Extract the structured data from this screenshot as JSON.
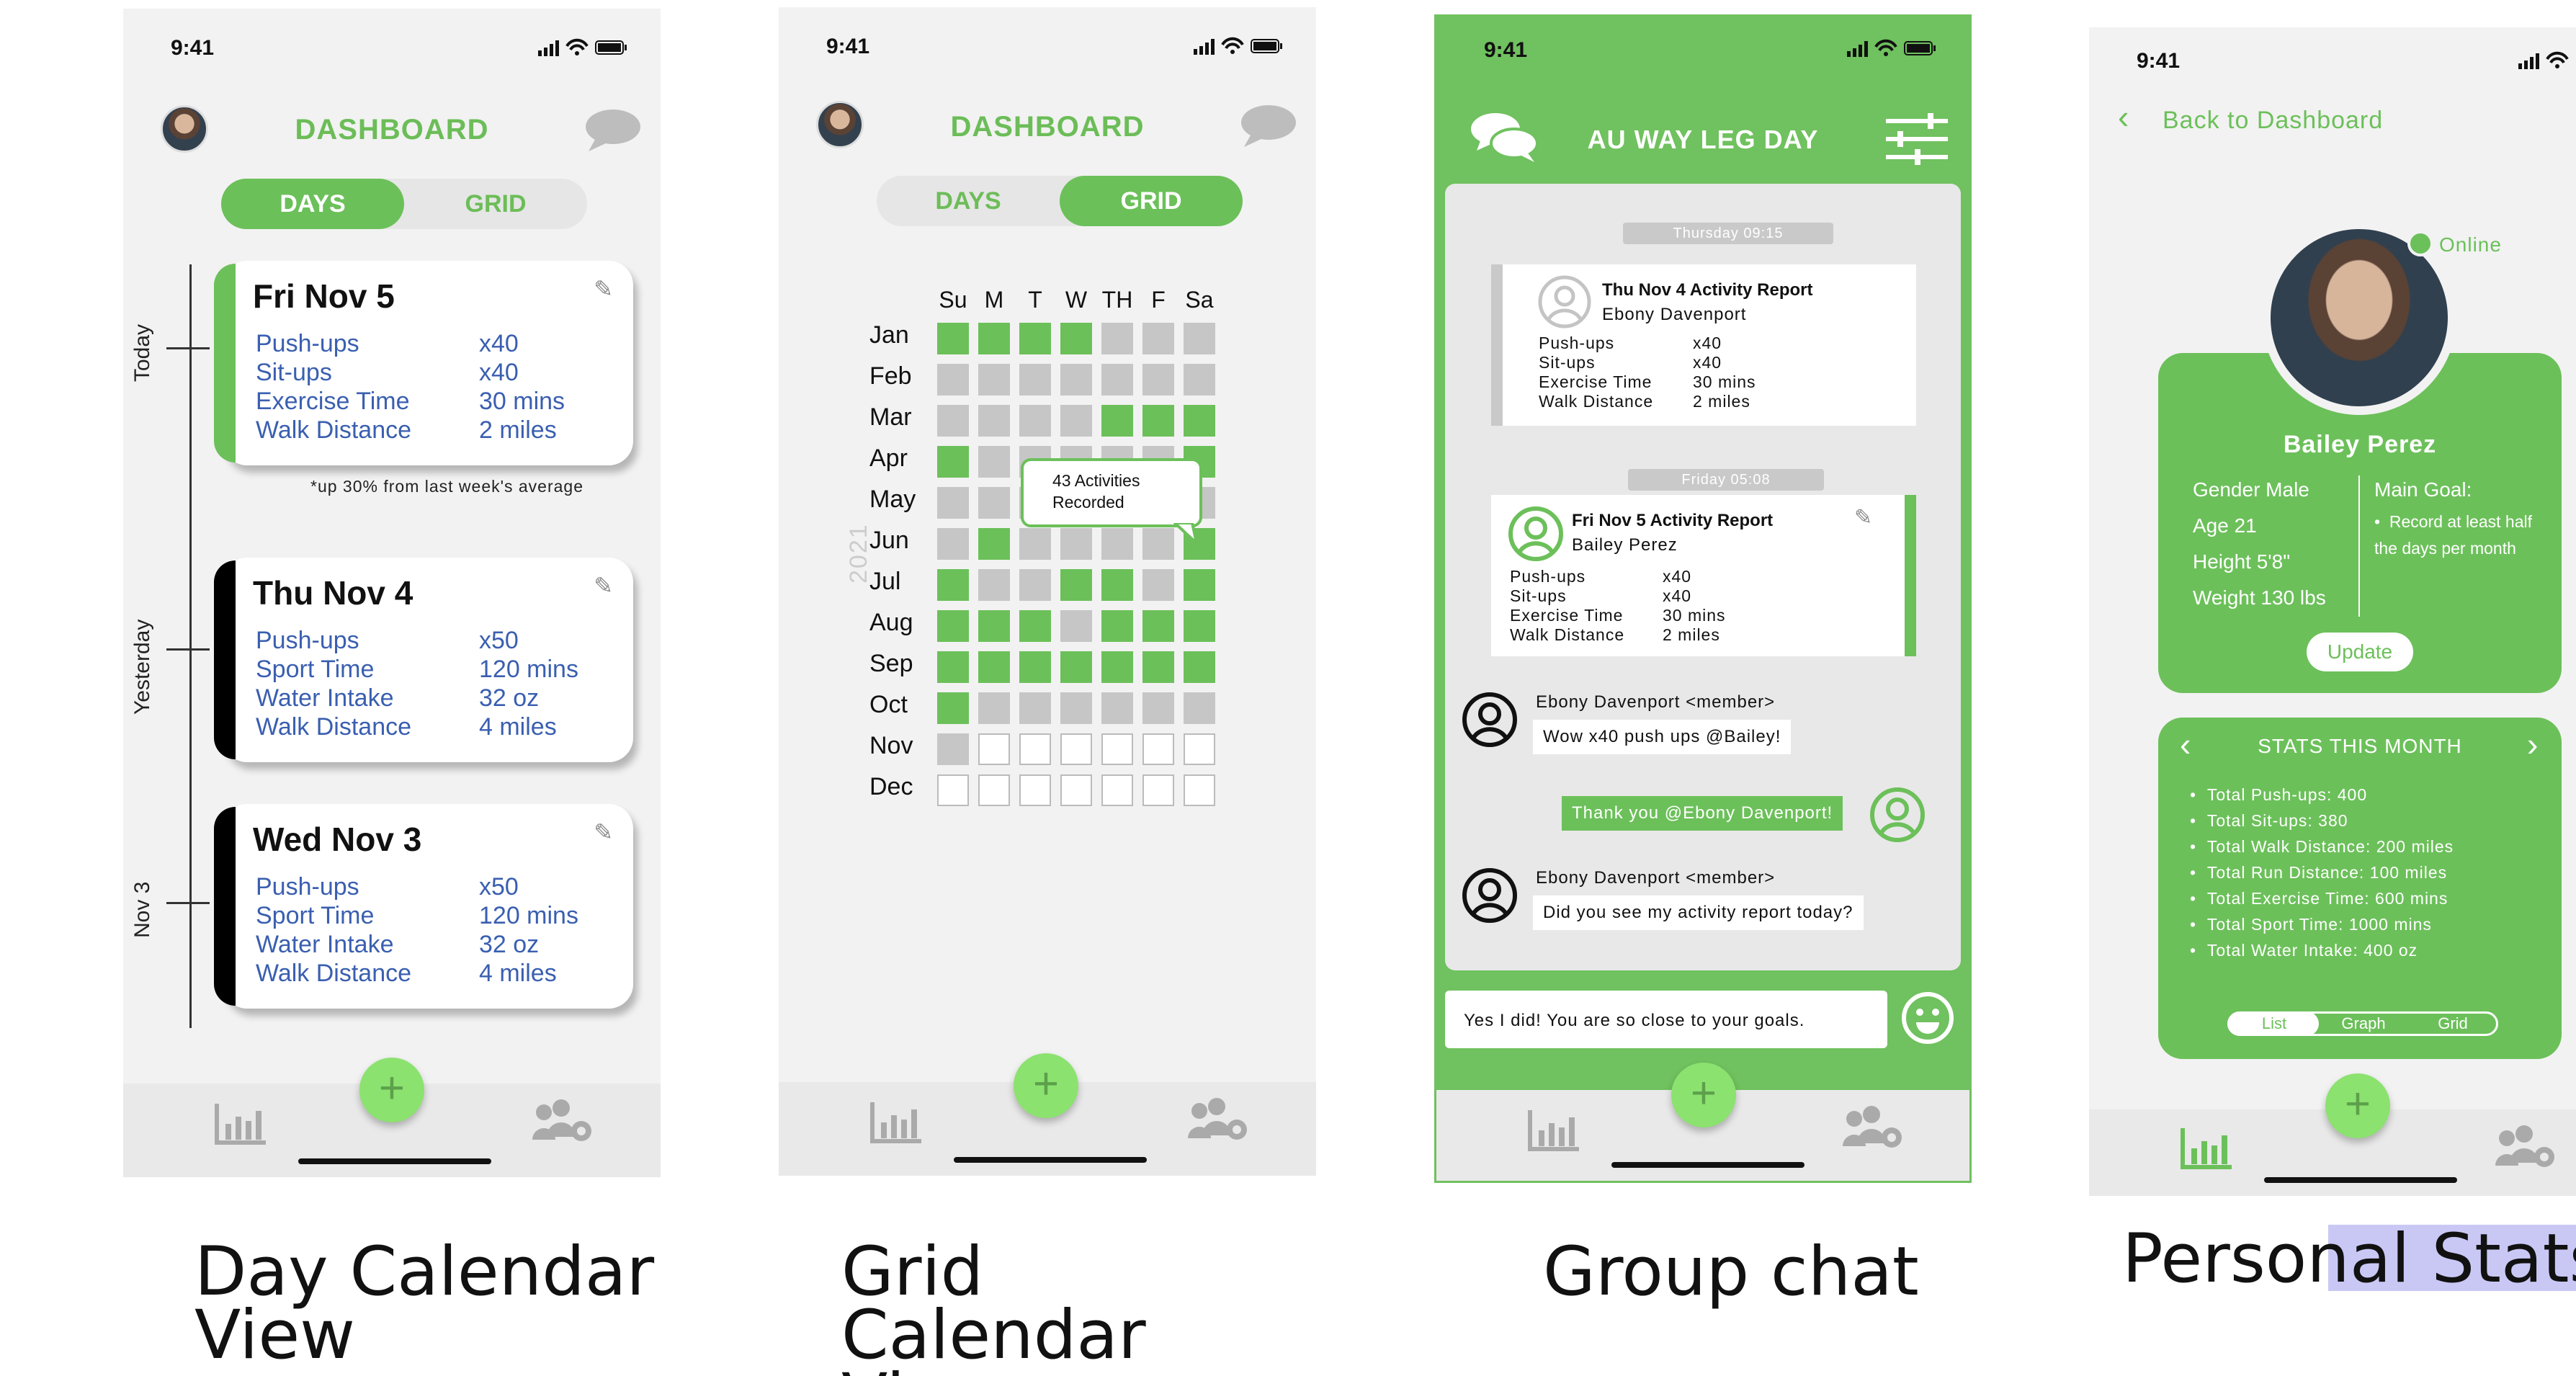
{
  "colors": {
    "green": "#6cc05a",
    "green_light": "#8be26f",
    "blue_text": "#3a5fb0",
    "gray_cell": "#c6c6c6",
    "background": "#f2f2f2"
  },
  "status": {
    "time": "9:41"
  },
  "tabbar": {
    "add_symbol": "+",
    "chart_icon": "bar-chart-icon",
    "team_icon": "team-settings-icon"
  },
  "screen1": {
    "title": "DASHBOARD",
    "toggle": {
      "days": "DAYS",
      "grid": "GRID",
      "selected": "DAYS"
    },
    "side_labels": {
      "today": "Today",
      "yesterday": "Yesterday",
      "nov3": "Nov 3"
    },
    "cards": [
      {
        "date": "Fri Nov 5",
        "rows": [
          {
            "label": "Push-ups",
            "value": "x40"
          },
          {
            "label": "Sit-ups",
            "value": "x40"
          },
          {
            "label": "Exercise Time",
            "value": "30 mins"
          },
          {
            "label": "Walk Distance",
            "value": "2 miles"
          }
        ]
      },
      {
        "date": "Thu Nov 4",
        "rows": [
          {
            "label": "Push-ups",
            "value": "x50"
          },
          {
            "label": "Sport Time",
            "value": "120 mins"
          },
          {
            "label": "Water Intake",
            "value": "32 oz"
          },
          {
            "label": "Walk Distance",
            "value": "4 miles"
          }
        ]
      },
      {
        "date": "Wed Nov 3",
        "rows": [
          {
            "label": "Push-ups",
            "value": "x50"
          },
          {
            "label": "Sport Time",
            "value": "120 mins"
          },
          {
            "label": "Water Intake",
            "value": "32 oz"
          },
          {
            "label": "Walk Distance",
            "value": "4 miles"
          }
        ]
      }
    ],
    "note": "*up 30% from last week's average"
  },
  "screen2": {
    "title": "DASHBOARD",
    "toggle": {
      "days": "DAYS",
      "grid": "GRID",
      "selected": "GRID"
    },
    "year": "2021",
    "weekdays": [
      "Su",
      "M",
      "T",
      "W",
      "TH",
      "F",
      "Sa"
    ],
    "months": [
      "Jan",
      "Feb",
      "Mar",
      "Apr",
      "May",
      "Jun",
      "Jul",
      "Aug",
      "Sep",
      "Oct",
      "Nov",
      "Dec"
    ],
    "cells": [
      "ggggxxx",
      "xxxxxxx",
      "xxxxggg",
      "gxxxxxg",
      "xxxxxxx",
      "xgxxxxg",
      "gxxggxg",
      "gggxggg",
      "ggggggg",
      "gxxxxxx",
      "xeeeeee",
      "eeeeeee"
    ],
    "tooltip": {
      "line1": "43 Activities",
      "line2": "Recorded"
    }
  },
  "screen3": {
    "title": "AU WAY LEG DAY",
    "date1": "Thursday 09:15",
    "date2": "Friday 05:08",
    "report1": {
      "title": "Thu Nov 4 Activity Report",
      "name": "Ebony Davenport",
      "rows": [
        {
          "label": "Push-ups",
          "value": "x40"
        },
        {
          "label": "Sit-ups",
          "value": "x40"
        },
        {
          "label": "Exercise Time",
          "value": "30 mins"
        },
        {
          "label": "Walk Distance",
          "value": "2 miles"
        }
      ]
    },
    "report2": {
      "title": "Fri Nov 5 Activity Report",
      "name": "Bailey Perez",
      "rows": [
        {
          "label": "Push-ups",
          "value": "x40"
        },
        {
          "label": "Sit-ups",
          "value": "x40"
        },
        {
          "label": "Exercise Time",
          "value": "30 mins"
        },
        {
          "label": "Walk Distance",
          "value": "2 miles"
        }
      ]
    },
    "messages": [
      {
        "name": "Ebony Davenport <member>",
        "text": "Wow x40 push ups @Bailey!"
      },
      {
        "name": "",
        "text": "Thank you @Ebony Davenport!"
      },
      {
        "name": "Ebony Davenport <member>",
        "text": "Did you see my activity report today?"
      }
    ],
    "input_value": "Yes I did! You are so close to your goals."
  },
  "screen4": {
    "back": "Back to Dashboard",
    "online": "Online",
    "name": "Bailey Perez",
    "profile": {
      "gender": "Gender Male",
      "age": "Age 21",
      "height": "Height 5'8\"",
      "weight": "Weight 130 lbs"
    },
    "goal_title": "Main Goal:",
    "goal_text": "Record at least half the days per month",
    "update": "Update",
    "stats_title": "STATS THIS MONTH",
    "stats": [
      "Total Push-ups: 400",
      "Total Sit-ups: 380",
      "Total Walk Distance: 200 miles",
      "Total Run Distance: 100 miles",
      "Total Exercise Time: 600 mins",
      "Total Sport Time: 1000 mins",
      "Total Water Intake: 400 oz"
    ],
    "view_tabs": [
      "List",
      "Graph",
      "Grid"
    ],
    "view_selected": "List"
  },
  "captions": {
    "c1": "Day Calendar View",
    "c2": "Grid Calendar View",
    "c3": "Group chat",
    "c4": "Personal Stats"
  }
}
